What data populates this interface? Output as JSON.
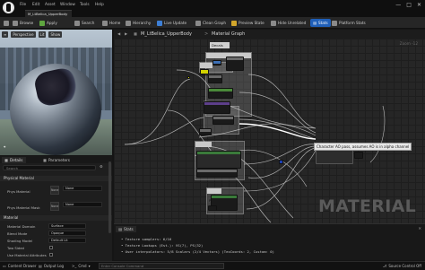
{
  "menu": [
    "File",
    "Edit",
    "Asset",
    "Window",
    "Tools",
    "Help"
  ],
  "asset_tab": "M_LtBelica_UpperBody",
  "window_controls": [
    "—",
    "□",
    "✕"
  ],
  "toolbar": {
    "save": "",
    "browse": "Browse",
    "apply": "Apply",
    "search": "Search",
    "home": "Home",
    "hierarchy": "Hierarchy",
    "live_update": "Live Update",
    "clean_graph": "Clean Graph",
    "preview_state": "Preview State",
    "hide_unrelated": "Hide Unrelated",
    "stats": "Stats",
    "platform_stats": "Platform Stats"
  },
  "viewport": {
    "perspective": "Perspective",
    "lit": "Lit",
    "show": "Show",
    "axis": "⌖"
  },
  "details": {
    "tab_details": "Details",
    "tab_parameters": "Parameters",
    "search_placeholder": "Search",
    "sections": {
      "physical_material": "Physical Material",
      "material": "Material"
    },
    "props": [
      {
        "label": "Phys Material",
        "value": "None"
      },
      {
        "label": "Phys Material Mask",
        "value": "None"
      },
      {
        "label": "Material Domain",
        "value": "Surface"
      },
      {
        "label": "Blend Mode",
        "value": "Opaque"
      },
      {
        "label": "Shading Model",
        "value": "Default Lit"
      },
      {
        "label": "Two Sided",
        "value": ""
      },
      {
        "label": "Use Material Attributes",
        "value": ""
      }
    ],
    "thumb_none": "None"
  },
  "graph": {
    "breadcrumb_asset": "M_LtBelica_UpperBody",
    "breadcrumb_sep": ">",
    "breadcrumb_graph": "Material Graph",
    "zoom": "Zoom -12",
    "watermark": "MATERIAL",
    "comments": [
      "Decals",
      "Gear",
      "Rubber",
      "Plastic",
      ""
    ],
    "tooltip": "Character AO pass, assumes AO is in alpha channel"
  },
  "stats": {
    "tab": "Stats",
    "lines": [
      "• Texture samplers: 6/16",
      "• Texture Lookups (Est.): VS(7), PS(32)",
      "• User interpolators: 5/8 Scalars (2/4 Vectors) (TexCoords: 2, Custom: 0)"
    ]
  },
  "statusbar": {
    "content_drawer": "Content Drawer",
    "output_log": "Output Log",
    "cmd": "Cmd",
    "cmd_placeholder": "Enter Console Command",
    "source_control": "Source Control Off"
  }
}
